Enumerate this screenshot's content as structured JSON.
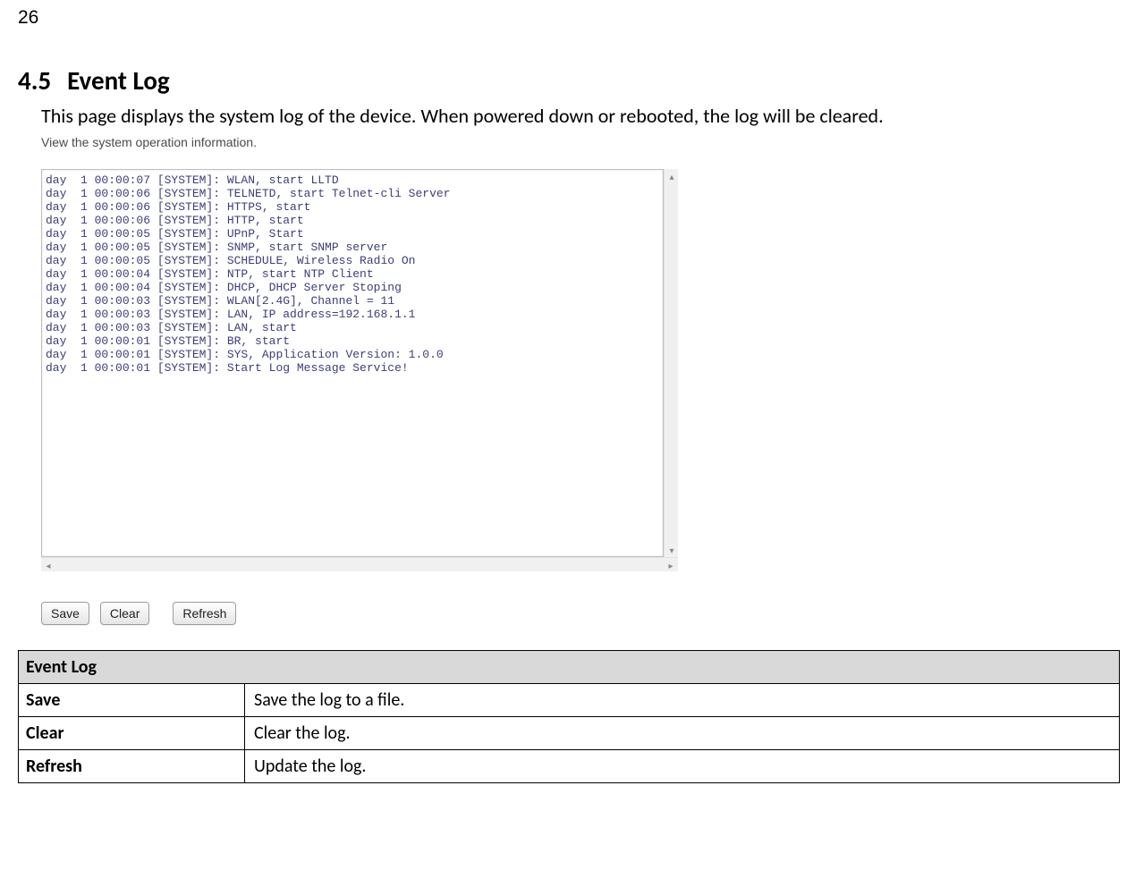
{
  "page_number": "26",
  "heading_number": "4.5",
  "heading_text": "Event Log",
  "intro_text": "This page displays the system log of the device. When powered down or rebooted, the log will be cleared.",
  "screenshot": {
    "caption": "View the system operation information.",
    "log_lines": [
      "day  1 00:00:07 [SYSTEM]: WLAN, start LLTD",
      "day  1 00:00:06 [SYSTEM]: TELNETD, start Telnet-cli Server",
      "day  1 00:00:06 [SYSTEM]: HTTPS, start",
      "day  1 00:00:06 [SYSTEM]: HTTP, start",
      "day  1 00:00:05 [SYSTEM]: UPnP, Start",
      "day  1 00:00:05 [SYSTEM]: SNMP, start SNMP server",
      "day  1 00:00:05 [SYSTEM]: SCHEDULE, Wireless Radio On",
      "day  1 00:00:04 [SYSTEM]: NTP, start NTP Client",
      "day  1 00:00:04 [SYSTEM]: DHCP, DHCP Server Stoping",
      "day  1 00:00:03 [SYSTEM]: WLAN[2.4G], Channel = 11",
      "day  1 00:00:03 [SYSTEM]: LAN, IP address=192.168.1.1",
      "day  1 00:00:03 [SYSTEM]: LAN, start",
      "day  1 00:00:01 [SYSTEM]: BR, start",
      "day  1 00:00:01 [SYSTEM]: SYS, Application Version: 1.0.0",
      "day  1 00:00:01 [SYSTEM]: Start Log Message Service!"
    ],
    "buttons": {
      "save": "Save",
      "clear": "Clear",
      "refresh": "Refresh"
    }
  },
  "table": {
    "header": "Event Log",
    "rows": [
      {
        "label": "Save",
        "desc": "Save the log to a file."
      },
      {
        "label": "Clear",
        "desc": "Clear the log."
      },
      {
        "label": "Refresh",
        "desc": "Update the log."
      }
    ]
  }
}
